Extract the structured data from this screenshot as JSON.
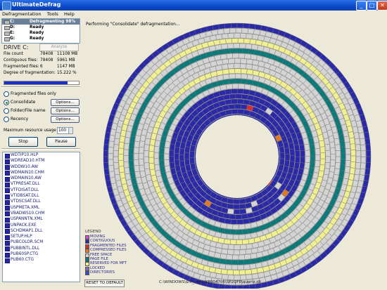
{
  "window": {
    "title": "UltimateDefrag",
    "minimize": "_",
    "maximize": "□",
    "close": "✕",
    "app_icon": "app-icon"
  },
  "menu": [
    "Defragmentation",
    "Tools",
    "Help"
  ],
  "drives": [
    {
      "letter": "C:",
      "status": "Defragmenting 98%",
      "selected": true
    },
    {
      "letter": "D:",
      "status": "Ready",
      "selected": false
    },
    {
      "letter": "E:",
      "status": "Ready",
      "selected": false
    },
    {
      "letter": "G:",
      "status": "Ready",
      "selected": false
    }
  ],
  "drive_info": {
    "heading": "DRIVE C:",
    "analyze_label": "Analyze",
    "file_count_label": "File count",
    "file_count": "78408",
    "file_count_size": "11108 MB",
    "contiguous_label": "Contiguous files:",
    "contiguous": "78408",
    "contiguous_size": "5961 MB",
    "fragmented_label": "Fragmented files:",
    "fragmented": "6",
    "fragmented_size": "1147 MB",
    "degree_label": "Degree of fragmentation:",
    "degree": "15.222 %"
  },
  "progress": 0.85,
  "options": {
    "fragmented_only": "Fragmented files only",
    "methods": [
      {
        "label": "Consolidate",
        "selected": true,
        "button": "Options..."
      },
      {
        "label": "Folder/File name",
        "selected": false,
        "button": "Options..."
      },
      {
        "label": "Recency",
        "selected": false,
        "button": "Options..."
      }
    ],
    "resource_label": "Maximum resource usage %:",
    "resource_value": "100",
    "stop_label": "Stop",
    "pause_label": "Pause"
  },
  "files": [
    "WDTIP10.HLP",
    "WDREAD10.HTM",
    "WDDW10.AW",
    "WDMAIN10.CHM",
    "WDMAIN10.AW",
    "VTPRESAT.DLL",
    "VTFDISAT.DLL",
    "VTIDBSAT.DLL",
    "VTDSCSAT.DLL",
    "USPMETA.XML",
    "VBADWS10.CHM",
    "USPANNTN.XML",
    "UNPACK.EXE",
    "SCHDMAP1.DLL",
    "SETUP.HLP",
    "PUBCOLOR.SCM",
    "PUBBINTL.DLL",
    "PUB60SP.CTG",
    "PUB60.CTG"
  ],
  "status_text": "Performing \"Consolidate\" defragmentation...",
  "legend": {
    "title": "LEGEND",
    "items": [
      {
        "label": "MOVING",
        "color": "#c850c8"
      },
      {
        "label": "CONTIGUOUS",
        "color": "#2a2aa8"
      },
      {
        "label": "FRAGMENTED FILES",
        "color": "#d83030"
      },
      {
        "label": "COMPRESSED FILES",
        "color": "#e07820"
      },
      {
        "label": "FREE SPACE",
        "color": "#d4d4d4"
      },
      {
        "label": "PAGE FILE",
        "color": "#0a7a7a"
      },
      {
        "label": "RESERVED FOR MFT",
        "color": "#f0f090"
      },
      {
        "label": "LOCKED",
        "color": "#8a6ab0"
      },
      {
        "label": "DIRECTORIES",
        "color": "#3050d0"
      }
    ]
  },
  "reset_label": "RESET TO DEFAULT",
  "current_file": "C:\\WINDOWS\\$hf_mig$\\KB904706\\SP2QFE\\quartz.dll",
  "colors": {
    "free": "#d4d4d4",
    "used": "#2a2aa8",
    "page": "#0a7a7a",
    "mft": "#f0f090",
    "fragmented": "#d83030",
    "compressed": "#e07820",
    "grid": "#6f6f6f"
  }
}
